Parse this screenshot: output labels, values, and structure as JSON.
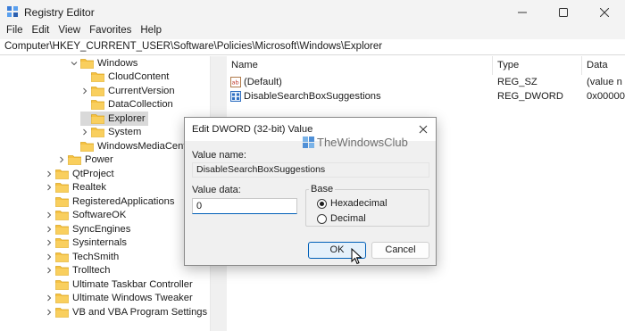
{
  "window": {
    "title": "Registry Editor",
    "controls": {
      "minimize": "minimize-icon",
      "maximize": "maximize-icon",
      "close": "close-icon"
    }
  },
  "menu": [
    "File",
    "Edit",
    "View",
    "Favorites",
    "Help"
  ],
  "address": "Computer\\HKEY_CURRENT_USER\\Software\\Policies\\Microsoft\\Windows\\Explorer",
  "tree": [
    {
      "label": "Windows",
      "expanded": true
    },
    {
      "label": "CloudContent"
    },
    {
      "label": "CurrentVersion",
      "has_children": true
    },
    {
      "label": "DataCollection"
    },
    {
      "label": "Explorer",
      "selected": true
    },
    {
      "label": "System",
      "has_children": true
    },
    {
      "label": "WindowsMediaCenter"
    },
    {
      "label": "Power",
      "has_children": true
    },
    {
      "label": "QtProject",
      "has_children": true
    },
    {
      "label": "Realtek",
      "has_children": true
    },
    {
      "label": "RegisteredApplications"
    },
    {
      "label": "SoftwareOK",
      "has_children": true
    },
    {
      "label": "SyncEngines",
      "has_children": true
    },
    {
      "label": "Sysinternals",
      "has_children": true
    },
    {
      "label": "TechSmith",
      "has_children": true
    },
    {
      "label": "Trolltech",
      "has_children": true
    },
    {
      "label": "Ultimate Taskbar Controller"
    },
    {
      "label": "Ultimate Windows Tweaker",
      "has_children": true
    },
    {
      "label": "VB and VBA Program Settings",
      "has_children": true
    }
  ],
  "list": {
    "columns": [
      "Name",
      "Type",
      "Data"
    ],
    "rows": [
      {
        "icon": "string-value-icon",
        "name": "(Default)",
        "type": "REG_SZ",
        "data": "(value n"
      },
      {
        "icon": "dword-value-icon",
        "name": "DisableSearchBoxSuggestions",
        "type": "REG_DWORD",
        "data": "0x00000"
      }
    ]
  },
  "dialog": {
    "title": "Edit DWORD (32-bit) Value",
    "value_name_label": "Value name:",
    "value_name": "DisableSearchBoxSuggestions",
    "value_data_label": "Value data:",
    "value_data": "0",
    "base_label": "Base",
    "base_options": [
      {
        "label": "Hexadecimal",
        "selected": true
      },
      {
        "label": "Decimal",
        "selected": false
      }
    ],
    "ok_label": "OK",
    "cancel_label": "Cancel"
  },
  "watermark": "TheWindowsClub",
  "colors": {
    "accent": "#005fb8",
    "folder": "#f6c142",
    "selection": "#d9d9d9"
  }
}
